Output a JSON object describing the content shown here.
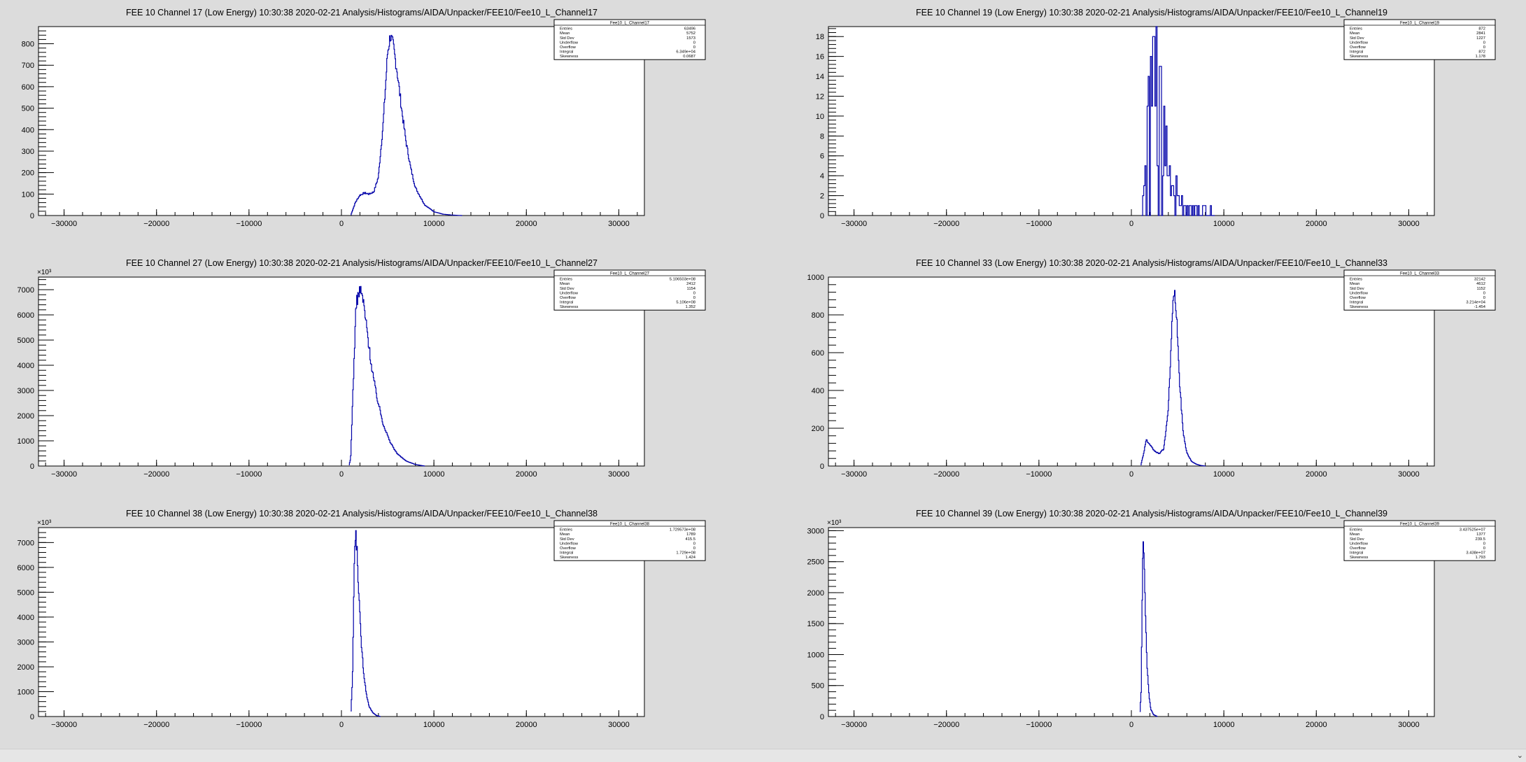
{
  "app": {
    "status_arrow": "⌄"
  },
  "chart_data": [
    {
      "type": "histogram",
      "title": "FEE 10 Channel 17 (Low Energy)  10:30:38  2020-02-21  Analysis/Histograms/AIDA/Unpacker/FEE10/Fee10_L_Channel17",
      "xlim": [
        -32768,
        32768
      ],
      "ylim": [
        0,
        880
      ],
      "yticks": [
        0,
        100,
        200,
        300,
        400,
        500,
        600,
        700,
        800
      ],
      "ytick_labels": [
        "0",
        "100",
        "200",
        "300",
        "400",
        "500",
        "600",
        "700",
        "800"
      ],
      "y_multiplier": "",
      "xticks": [
        -30000,
        -20000,
        -10000,
        0,
        10000,
        20000,
        30000
      ],
      "xtick_labels": [
        "−30000",
        "−20000",
        "−10000",
        "0",
        "10000",
        "20000",
        "30000"
      ],
      "x": [
        1000,
        1500,
        2000,
        2500,
        3000,
        3500,
        4000,
        4500,
        5000,
        5300,
        5600,
        6000,
        6500,
        7000,
        7500,
        8000,
        9000,
        10000,
        11000,
        12000,
        13000
      ],
      "y": [
        0,
        60,
        95,
        105,
        100,
        110,
        180,
        420,
        760,
        840,
        790,
        680,
        500,
        340,
        220,
        130,
        50,
        18,
        6,
        2,
        0
      ],
      "noisy": false,
      "stats": {
        "name": "Fee10_L_Channel17",
        "rows": [
          {
            "label": "Entries",
            "value": "63496"
          },
          {
            "label": "Mean",
            "value": "5752"
          },
          {
            "label": "Std Dev",
            "value": "1573"
          },
          {
            "label": "Underflow",
            "value": "0"
          },
          {
            "label": "Overflow",
            "value": "0"
          },
          {
            "label": "Integral",
            "value": "6.349e+04"
          },
          {
            "label": "Skewness",
            "value": "0.0687"
          }
        ]
      }
    },
    {
      "type": "histogram",
      "title": "FEE 10 Channel 19 (Low Energy)  10:30:38  2020-02-21  Analysis/Histograms/AIDA/Unpacker/FEE10/Fee10_L_Channel19",
      "xlim": [
        -32768,
        32768
      ],
      "ylim": [
        0,
        19
      ],
      "yticks": [
        0,
        2,
        4,
        6,
        8,
        10,
        12,
        14,
        16,
        18
      ],
      "ytick_labels": [
        "0",
        "2",
        "4",
        "6",
        "8",
        "10",
        "12",
        "14",
        "16",
        "18"
      ],
      "y_multiplier": "",
      "xticks": [
        -30000,
        -20000,
        -10000,
        0,
        10000,
        20000,
        30000
      ],
      "xtick_labels": [
        "−30000",
        "−20000",
        "−10000",
        "0",
        "10000",
        "20000",
        "30000"
      ],
      "x": [
        1100,
        1500,
        2000,
        2500,
        3000,
        3500,
        4000,
        4500,
        5000,
        5500,
        6000,
        7000,
        8000,
        9000
      ],
      "y": [
        0,
        6,
        14,
        17,
        13,
        9,
        6,
        4,
        3,
        2,
        1,
        1,
        1,
        0
      ],
      "noisy": true,
      "stats": {
        "name": "Fee10_L_Channel19",
        "rows": [
          {
            "label": "Entries",
            "value": "872"
          },
          {
            "label": "Mean",
            "value": "2841"
          },
          {
            "label": "Std Dev",
            "value": "1227"
          },
          {
            "label": "Underflow",
            "value": "0"
          },
          {
            "label": "Overflow",
            "value": "0"
          },
          {
            "label": "Integral",
            "value": "872"
          },
          {
            "label": "Skewness",
            "value": "1.178"
          }
        ]
      }
    },
    {
      "type": "histogram",
      "title": "FEE 10 Channel 27 (Low Energy)  10:30:38  2020-02-21  Analysis/Histograms/AIDA/Unpacker/FEE10/Fee10_L_Channel27",
      "xlim": [
        -32768,
        32768
      ],
      "ylim": [
        0,
        7500
      ],
      "yticks": [
        0,
        1000,
        2000,
        3000,
        4000,
        5000,
        6000,
        7000
      ],
      "ytick_labels": [
        "0",
        "1000",
        "2000",
        "3000",
        "4000",
        "5000",
        "6000",
        "7000"
      ],
      "y_multiplier": "×10³",
      "xticks": [
        -30000,
        -20000,
        -10000,
        0,
        10000,
        20000,
        30000
      ],
      "xtick_labels": [
        "−30000",
        "−20000",
        "−10000",
        "0",
        "10000",
        "20000",
        "30000"
      ],
      "x": [
        800,
        1000,
        1300,
        1600,
        2000,
        2300,
        2700,
        3200,
        3800,
        4500,
        5200,
        6000,
        7000,
        8000,
        9000
      ],
      "y": [
        0,
        300,
        3500,
        6500,
        7000,
        6700,
        5600,
        4100,
        2800,
        1700,
        1000,
        500,
        200,
        60,
        0
      ],
      "noisy": false,
      "stats": {
        "name": "Fee10_L_Channel27",
        "rows": [
          {
            "label": "Entries",
            "value": "5.106503e+08"
          },
          {
            "label": "Mean",
            "value": "2412"
          },
          {
            "label": "Std Dev",
            "value": "1154"
          },
          {
            "label": "Underflow",
            "value": "0"
          },
          {
            "label": "Overflow",
            "value": "0"
          },
          {
            "label": "Integral",
            "value": "5.106e+08"
          },
          {
            "label": "Skewness",
            "value": "1.352"
          }
        ]
      }
    },
    {
      "type": "histogram",
      "title": "FEE 10 Channel 33 (Low Energy)  10:30:38  2020-02-21  Analysis/Histograms/AIDA/Unpacker/FEE10/Fee10_L_Channel33",
      "xlim": [
        -32768,
        32768
      ],
      "ylim": [
        0,
        1000
      ],
      "yticks": [
        0,
        200,
        400,
        600,
        800,
        1000
      ],
      "ytick_labels": [
        "0",
        "200",
        "400",
        "600",
        "800",
        "1000"
      ],
      "y_multiplier": "",
      "xticks": [
        -30000,
        -20000,
        -10000,
        0,
        10000,
        20000,
        30000
      ],
      "xtick_labels": [
        "−30000",
        "−20000",
        "−10000",
        "0",
        "10000",
        "20000",
        "30000"
      ],
      "x": [
        1000,
        1300,
        1600,
        2000,
        2500,
        3000,
        3500,
        4000,
        4300,
        4600,
        4900,
        5200,
        5600,
        6000,
        6500,
        7000,
        7500,
        8000
      ],
      "y": [
        0,
        60,
        140,
        110,
        80,
        65,
        90,
        300,
        650,
        940,
        800,
        450,
        180,
        70,
        25,
        10,
        3,
        0
      ],
      "noisy": false,
      "stats": {
        "name": "Fee10_L_Channel33",
        "rows": [
          {
            "label": "Entries",
            "value": "32142"
          },
          {
            "label": "Mean",
            "value": "4612"
          },
          {
            "label": "Std Dev",
            "value": "1152"
          },
          {
            "label": "Underflow",
            "value": "0"
          },
          {
            "label": "Overflow",
            "value": "0"
          },
          {
            "label": "Integral",
            "value": "3.214e+04"
          },
          {
            "label": "Skewness",
            "value": "-1.454"
          }
        ]
      }
    },
    {
      "type": "histogram",
      "title": "FEE 10 Channel 38 (Low Energy)  10:30:38  2020-02-21  Analysis/Histograms/AIDA/Unpacker/FEE10/Fee10_L_Channel38",
      "xlim": [
        -32768,
        32768
      ],
      "ylim": [
        0,
        7600
      ],
      "yticks": [
        0,
        1000,
        2000,
        3000,
        4000,
        5000,
        6000,
        7000
      ],
      "ytick_labels": [
        "0",
        "1000",
        "2000",
        "3000",
        "4000",
        "5000",
        "6000",
        "7000"
      ],
      "y_multiplier": "×10³",
      "xticks": [
        -30000,
        -20000,
        -10000,
        0,
        10000,
        20000,
        30000
      ],
      "xtick_labels": [
        "−30000",
        "−20000",
        "−10000",
        "0",
        "10000",
        "20000",
        "30000"
      ],
      "x": [
        1000,
        1200,
        1400,
        1550,
        1700,
        1900,
        2100,
        2400,
        2700,
        3000,
        3400,
        3800,
        4200
      ],
      "y": [
        0,
        1500,
        6500,
        7300,
        6600,
        4800,
        3200,
        1800,
        900,
        400,
        150,
        40,
        0
      ],
      "noisy": false,
      "stats": {
        "name": "Fee10_L_Channel38",
        "rows": [
          {
            "label": "Entries",
            "value": "1.729573e+08"
          },
          {
            "label": "Mean",
            "value": "1789"
          },
          {
            "label": "Std Dev",
            "value": "415.5"
          },
          {
            "label": "Underflow",
            "value": "0"
          },
          {
            "label": "Overflow",
            "value": "0"
          },
          {
            "label": "Integral",
            "value": "1.729e+08"
          },
          {
            "label": "Skewness",
            "value": "1.424"
          }
        ]
      }
    },
    {
      "type": "histogram",
      "title": "FEE 10 Channel 39 (Low Energy)  10:30:38  2020-02-21  Analysis/Histograms/AIDA/Unpacker/FEE10/Fee10_L_Channel39",
      "xlim": [
        -32768,
        32768
      ],
      "ylim": [
        0,
        3050
      ],
      "yticks": [
        0,
        500,
        1000,
        1500,
        2000,
        2500,
        3000
      ],
      "ytick_labels": [
        "0",
        "500",
        "1000",
        "1500",
        "2000",
        "2500",
        "3000"
      ],
      "y_multiplier": "×10³",
      "xticks": [
        -30000,
        -20000,
        -10000,
        0,
        10000,
        20000,
        30000
      ],
      "xtick_labels": [
        "−30000",
        "−20000",
        "−10000",
        "0",
        "10000",
        "20000",
        "30000"
      ],
      "x": [
        900,
        1050,
        1200,
        1300,
        1400,
        1550,
        1700,
        1900,
        2100,
        2400,
        2800
      ],
      "y": [
        0,
        400,
        2300,
        2850,
        2400,
        1500,
        800,
        350,
        120,
        30,
        0
      ],
      "noisy": false,
      "stats": {
        "name": "Fee10_L_Channel39",
        "rows": [
          {
            "label": "Entries",
            "value": "3.437525e+07"
          },
          {
            "label": "Mean",
            "value": "1377"
          },
          {
            "label": "Std Dev",
            "value": "239.5"
          },
          {
            "label": "Underflow",
            "value": "0"
          },
          {
            "label": "Overflow",
            "value": "0"
          },
          {
            "label": "Integral",
            "value": "3.438e+07"
          },
          {
            "label": "Skewness",
            "value": "1.793"
          }
        ]
      }
    }
  ]
}
